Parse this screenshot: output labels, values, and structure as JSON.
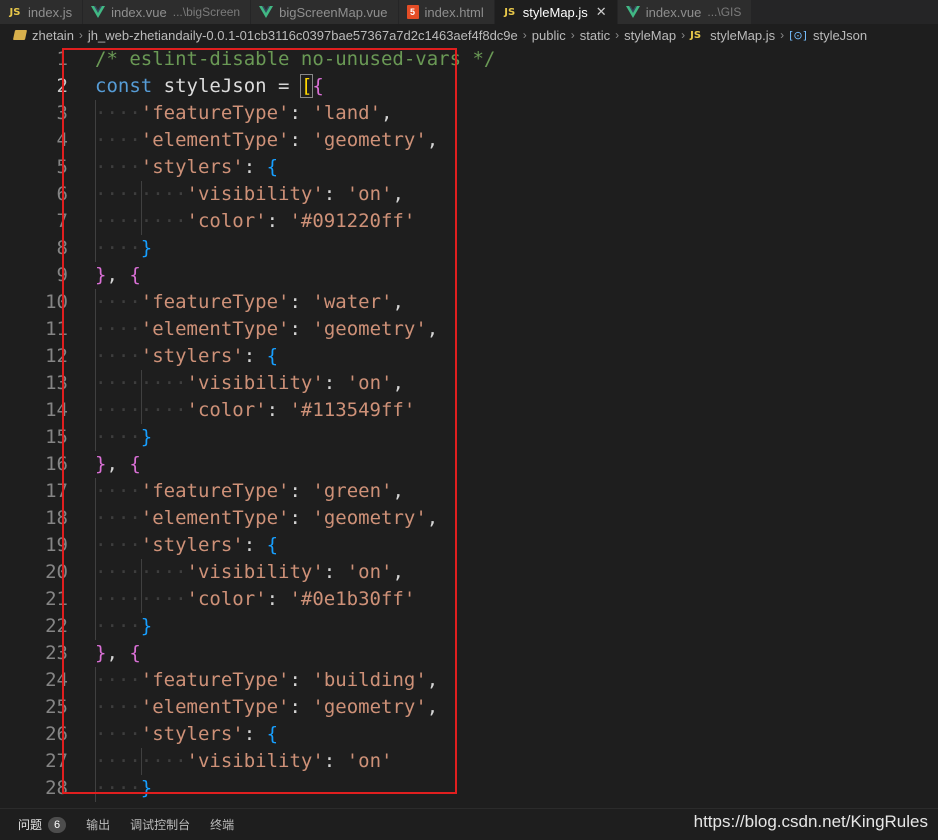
{
  "tabs": [
    {
      "icon": "js-icon",
      "label": "index.js",
      "desc": "",
      "active": false
    },
    {
      "icon": "vue-icon",
      "label": "index.vue",
      "desc": "...\\bigScreen",
      "active": false
    },
    {
      "icon": "vue-icon",
      "label": "bigScreenMap.vue",
      "desc": "",
      "active": false
    },
    {
      "icon": "html-icon",
      "label": "index.html",
      "desc": "",
      "active": false
    },
    {
      "icon": "js-icon",
      "label": "styleMap.js",
      "desc": "",
      "active": true,
      "close": "✕"
    },
    {
      "icon": "vue-icon",
      "label": "index.vue",
      "desc": "...\\GIS",
      "active": false
    }
  ],
  "breadcrumb": [
    {
      "icon": "folder-icon",
      "label": "zhetain"
    },
    {
      "icon": "",
      "label": "jh_web-zhetiandaily-0.0.1-01cb3116c0397bae57367a7d2c1463aef4f8dc9e"
    },
    {
      "icon": "",
      "label": "public"
    },
    {
      "icon": "",
      "label": "static"
    },
    {
      "icon": "",
      "label": "styleMap"
    },
    {
      "icon": "js-icon",
      "label": "styleMap.js"
    },
    {
      "icon": "symbol-variable-icon",
      "label": "styleJson"
    }
  ],
  "icons": {
    "js": "JS",
    "html": "5",
    "symbol": "[⊙]"
  },
  "editor": {
    "current_line": 2,
    "lines": [
      {
        "n": "1",
        "indent": 0,
        "tokens": [
          [
            "c",
            "/* eslint-disable no-unused-vars */"
          ]
        ]
      },
      {
        "n": "2",
        "indent": 0,
        "tokens": [
          [
            "kw",
            "const"
          ],
          [
            "p",
            " "
          ],
          [
            "v",
            "styleJson"
          ],
          [
            "p",
            " = "
          ],
          [
            "b1m",
            "["
          ],
          [
            "b2",
            "{"
          ]
        ]
      },
      {
        "n": "3",
        "indent": 1,
        "tokens": [
          [
            "s",
            "'featureType'"
          ],
          [
            "p",
            ": "
          ],
          [
            "s",
            "'land'"
          ],
          [
            "p",
            ","
          ]
        ]
      },
      {
        "n": "4",
        "indent": 1,
        "tokens": [
          [
            "s",
            "'elementType'"
          ],
          [
            "p",
            ": "
          ],
          [
            "s",
            "'geometry'"
          ],
          [
            "p",
            ","
          ]
        ]
      },
      {
        "n": "5",
        "indent": 1,
        "tokens": [
          [
            "s",
            "'stylers'"
          ],
          [
            "p",
            ": "
          ],
          [
            "b3",
            "{"
          ]
        ]
      },
      {
        "n": "6",
        "indent": 2,
        "tokens": [
          [
            "s",
            "'visibility'"
          ],
          [
            "p",
            ": "
          ],
          [
            "s",
            "'on'"
          ],
          [
            "p",
            ","
          ]
        ]
      },
      {
        "n": "7",
        "indent": 2,
        "tokens": [
          [
            "s",
            "'color'"
          ],
          [
            "p",
            ": "
          ],
          [
            "s",
            "'#091220ff'"
          ]
        ]
      },
      {
        "n": "8",
        "indent": 1,
        "tokens": [
          [
            "b3",
            "}"
          ]
        ]
      },
      {
        "n": "9",
        "indent": 0,
        "tokens": [
          [
            "b2",
            "}"
          ],
          [
            "p",
            ", "
          ],
          [
            "b2",
            "{"
          ]
        ]
      },
      {
        "n": "10",
        "indent": 1,
        "tokens": [
          [
            "s",
            "'featureType'"
          ],
          [
            "p",
            ": "
          ],
          [
            "s",
            "'water'"
          ],
          [
            "p",
            ","
          ]
        ]
      },
      {
        "n": "11",
        "indent": 1,
        "tokens": [
          [
            "s",
            "'elementType'"
          ],
          [
            "p",
            ": "
          ],
          [
            "s",
            "'geometry'"
          ],
          [
            "p",
            ","
          ]
        ]
      },
      {
        "n": "12",
        "indent": 1,
        "tokens": [
          [
            "s",
            "'stylers'"
          ],
          [
            "p",
            ": "
          ],
          [
            "b3",
            "{"
          ]
        ]
      },
      {
        "n": "13",
        "indent": 2,
        "tokens": [
          [
            "s",
            "'visibility'"
          ],
          [
            "p",
            ": "
          ],
          [
            "s",
            "'on'"
          ],
          [
            "p",
            ","
          ]
        ]
      },
      {
        "n": "14",
        "indent": 2,
        "tokens": [
          [
            "s",
            "'color'"
          ],
          [
            "p",
            ": "
          ],
          [
            "s",
            "'#113549ff'"
          ]
        ]
      },
      {
        "n": "15",
        "indent": 1,
        "tokens": [
          [
            "b3",
            "}"
          ]
        ]
      },
      {
        "n": "16",
        "indent": 0,
        "tokens": [
          [
            "b2",
            "}"
          ],
          [
            "p",
            ", "
          ],
          [
            "b2",
            "{"
          ]
        ]
      },
      {
        "n": "17",
        "indent": 1,
        "tokens": [
          [
            "s",
            "'featureType'"
          ],
          [
            "p",
            ": "
          ],
          [
            "s",
            "'green'"
          ],
          [
            "p",
            ","
          ]
        ]
      },
      {
        "n": "18",
        "indent": 1,
        "tokens": [
          [
            "s",
            "'elementType'"
          ],
          [
            "p",
            ": "
          ],
          [
            "s",
            "'geometry'"
          ],
          [
            "p",
            ","
          ]
        ]
      },
      {
        "n": "19",
        "indent": 1,
        "tokens": [
          [
            "s",
            "'stylers'"
          ],
          [
            "p",
            ": "
          ],
          [
            "b3",
            "{"
          ]
        ]
      },
      {
        "n": "20",
        "indent": 2,
        "tokens": [
          [
            "s",
            "'visibility'"
          ],
          [
            "p",
            ": "
          ],
          [
            "s",
            "'on'"
          ],
          [
            "p",
            ","
          ]
        ]
      },
      {
        "n": "21",
        "indent": 2,
        "tokens": [
          [
            "s",
            "'color'"
          ],
          [
            "p",
            ": "
          ],
          [
            "s",
            "'#0e1b30ff'"
          ]
        ]
      },
      {
        "n": "22",
        "indent": 1,
        "tokens": [
          [
            "b3",
            "}"
          ]
        ]
      },
      {
        "n": "23",
        "indent": 0,
        "tokens": [
          [
            "b2",
            "}"
          ],
          [
            "p",
            ", "
          ],
          [
            "b2",
            "{"
          ]
        ]
      },
      {
        "n": "24",
        "indent": 1,
        "tokens": [
          [
            "s",
            "'featureType'"
          ],
          [
            "p",
            ": "
          ],
          [
            "s",
            "'building'"
          ],
          [
            "p",
            ","
          ]
        ]
      },
      {
        "n": "25",
        "indent": 1,
        "tokens": [
          [
            "s",
            "'elementType'"
          ],
          [
            "p",
            ": "
          ],
          [
            "s",
            "'geometry'"
          ],
          [
            "p",
            ","
          ]
        ]
      },
      {
        "n": "26",
        "indent": 1,
        "tokens": [
          [
            "s",
            "'stylers'"
          ],
          [
            "p",
            ": "
          ],
          [
            "b3",
            "{"
          ]
        ]
      },
      {
        "n": "27",
        "indent": 2,
        "tokens": [
          [
            "s",
            "'visibility'"
          ],
          [
            "p",
            ": "
          ],
          [
            "s",
            "'on'"
          ]
        ]
      },
      {
        "n": "28",
        "indent": 1,
        "tokens": [
          [
            "b3",
            "}"
          ]
        ]
      }
    ]
  },
  "panel": {
    "tabs": [
      {
        "label": "问题",
        "badge": "6",
        "active": true
      },
      {
        "label": "输出",
        "badge": "",
        "active": false
      },
      {
        "label": "调试控制台",
        "badge": "",
        "active": false
      },
      {
        "label": "终端",
        "badge": "",
        "active": false
      }
    ]
  },
  "watermark": "https://blog.csdn.net/KingRules",
  "colors": {
    "editor_bg": "#1e1e1e",
    "comment": "#6a9955",
    "keyword": "#569cd6",
    "string": "#ce9178",
    "bracket_level1": "#ffd700",
    "bracket_level2": "#da70d6",
    "bracket_level3": "#179fff",
    "highlight_box": "#e01f1f"
  }
}
